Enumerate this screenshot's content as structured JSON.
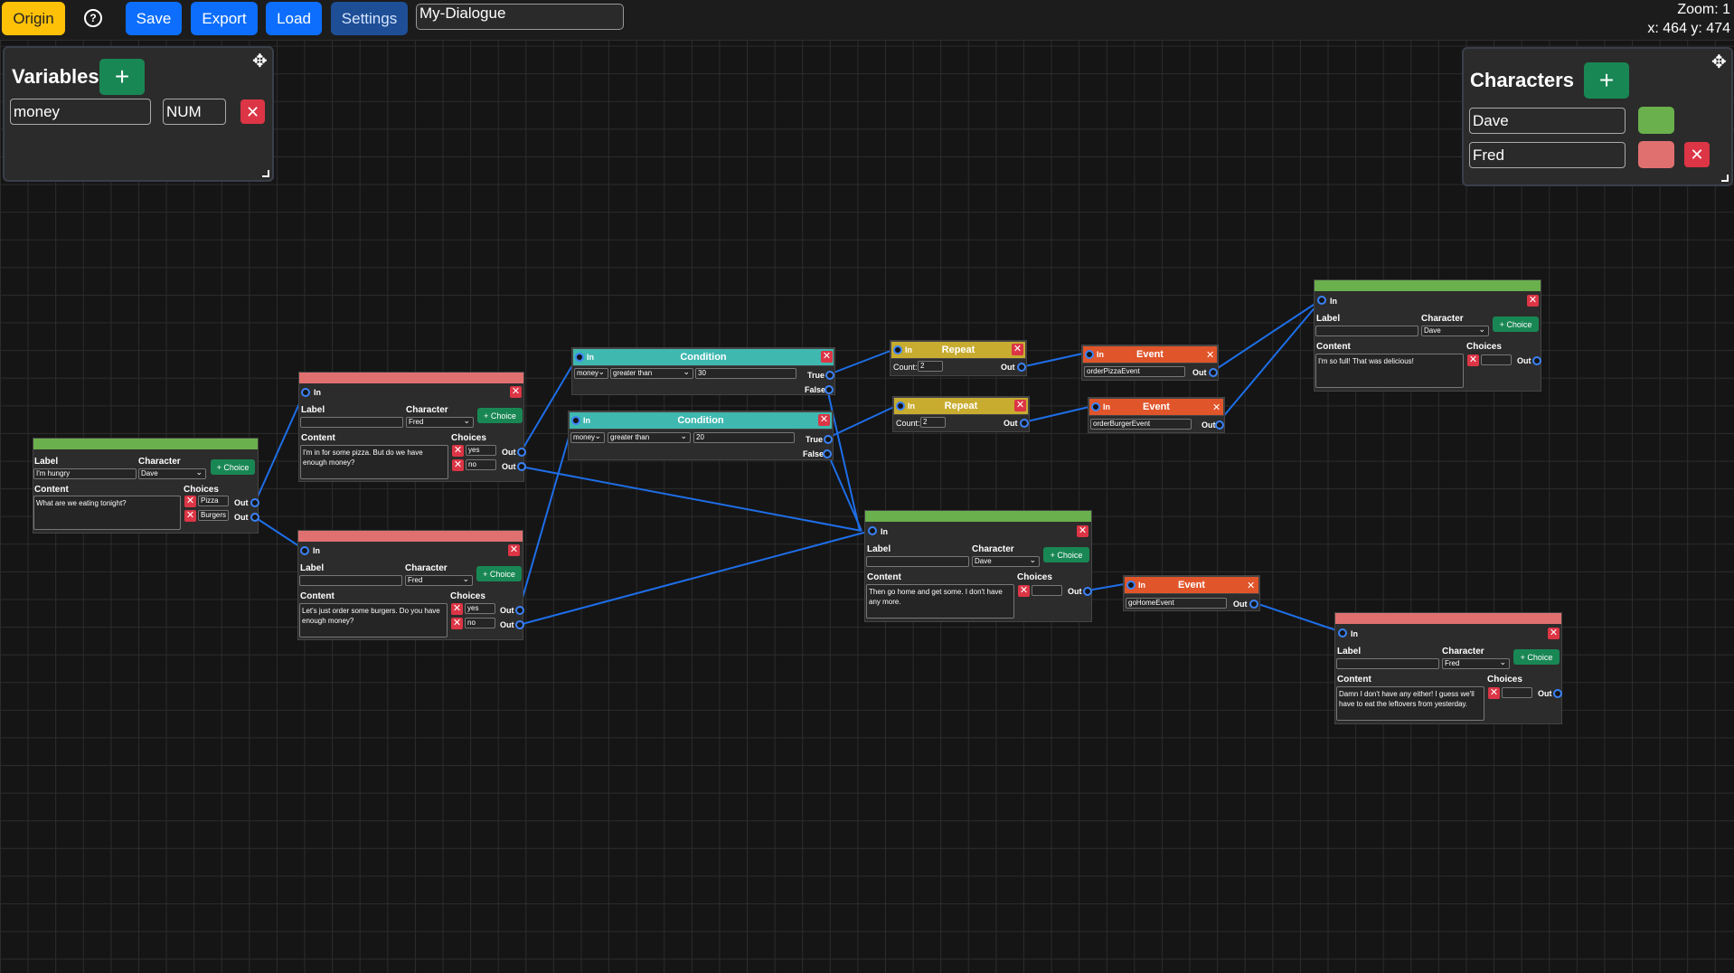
{
  "toolbar": {
    "origin": "Origin",
    "help": "?",
    "save": "Save",
    "export": "Export",
    "load": "Load",
    "settings": "Settings",
    "title": "My-Dialogue",
    "zoom_label": "Zoom: 1",
    "coords": "x: 464 y: 474"
  },
  "variables": {
    "title": "Variables",
    "items": [
      {
        "name": "money",
        "type": "NUM"
      }
    ]
  },
  "characters": {
    "title": "Characters",
    "items": [
      {
        "name": "Dave",
        "color": "#6ab04c"
      },
      {
        "name": "Fred",
        "color": "#e07070"
      }
    ]
  },
  "labels": {
    "in": "In",
    "out": "Out",
    "label": "Label",
    "character": "Character",
    "content": "Content",
    "choices": "Choices",
    "add_choice": "+ Choice",
    "true": "True",
    "false": "False",
    "count": "Count:"
  },
  "dialogues": {
    "d1": {
      "label": "I'm hungry",
      "character": "Dave",
      "content": "What are we eating tonight?",
      "choices": [
        "Pizza",
        "Burgers"
      ]
    },
    "d2": {
      "label": "",
      "character": "Fred",
      "content": "I'm in for some pizza. But do we have enough money?",
      "choices": [
        "yes",
        "no"
      ]
    },
    "d3": {
      "label": "",
      "character": "Fred",
      "content": "Let's just order some burgers. Do you have enough money?",
      "choices": [
        "yes",
        "no"
      ]
    },
    "d4": {
      "label": "",
      "character": "Dave",
      "content": "Then go home and get some. I don't have any more.",
      "choices": [
        ""
      ]
    },
    "d5": {
      "label": "",
      "character": "Dave",
      "content": "I'm so full! That was delicious!",
      "choices": [
        ""
      ]
    },
    "d6": {
      "label": "",
      "character": "Fred",
      "content": "Damn I don't have any either! I guess we'll have to eat the leftovers from yesterday.",
      "choices": [
        ""
      ]
    }
  },
  "conditions": {
    "c1": {
      "title": "Condition",
      "variable": "money",
      "operator": "greater than",
      "value": "30"
    },
    "c2": {
      "title": "Condition",
      "variable": "money",
      "operator": "greater than",
      "value": "20"
    }
  },
  "repeats": {
    "r1": {
      "title": "Repeat",
      "count": "2"
    },
    "r2": {
      "title": "Repeat",
      "count": "2"
    }
  },
  "events": {
    "e1": {
      "title": "Event",
      "name": "orderPizzaEvent"
    },
    "e2": {
      "title": "Event",
      "name": "orderBurgerEvent"
    },
    "e3": {
      "title": "Event",
      "name": "goHomeEvent"
    }
  },
  "colors": {
    "dave": "#6ab04c",
    "fred": "#e07070",
    "condition": "#3fb8b0",
    "repeat": "#c8ac30",
    "event": "#e0552a",
    "wire": "#1e6ee8",
    "primary": "#0d6efd",
    "origin": "#ffc107"
  }
}
